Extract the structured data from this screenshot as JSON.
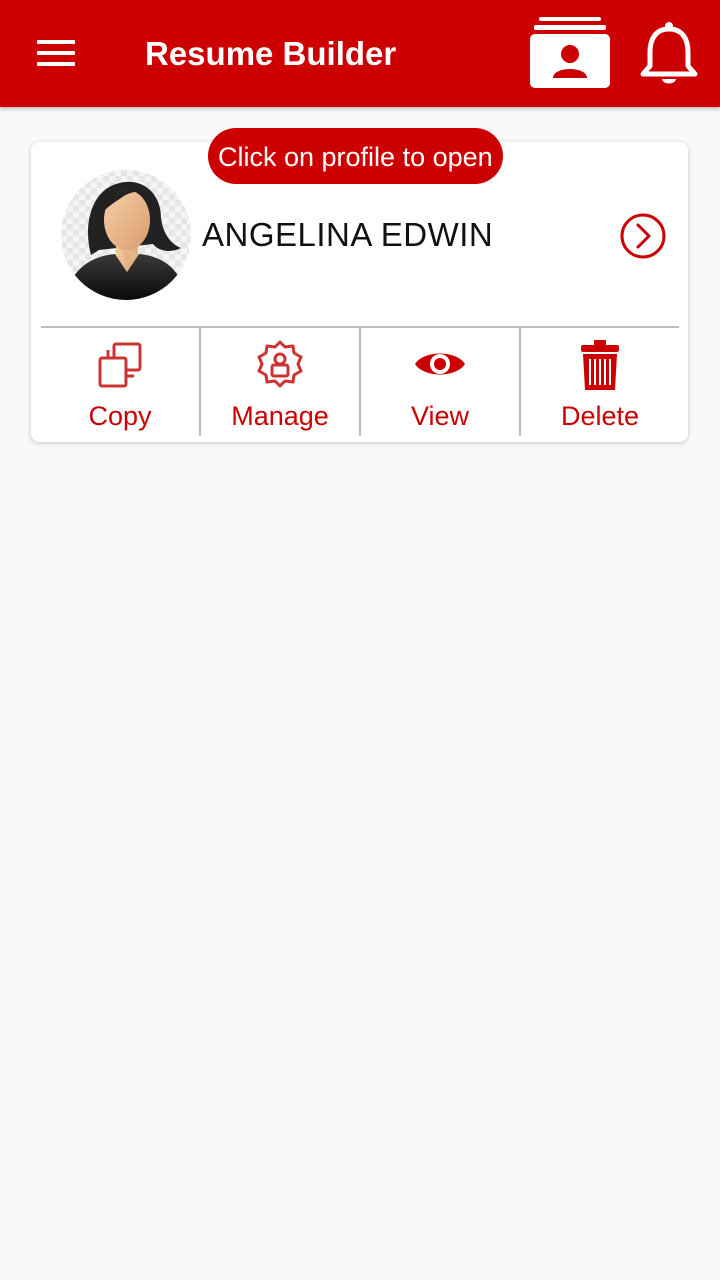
{
  "app": {
    "title": "Resume Builder",
    "accent": "#cc0000",
    "icons": {
      "menu": "hamburger-menu-icon",
      "profiles": "profile-cards-icon",
      "notifications": "bell-icon"
    }
  },
  "profile_card": {
    "hint": "Click on profile to open",
    "name": "ANGELINA EDWIN",
    "avatar": "female-avatar",
    "open_icon": "chevron-right-circle-icon",
    "actions": [
      {
        "label": "Copy",
        "icon": "copy-icon"
      },
      {
        "label": "Manage",
        "icon": "manage-profile-icon"
      },
      {
        "label": "View",
        "icon": "eye-icon"
      },
      {
        "label": "Delete",
        "icon": "trash-icon"
      }
    ]
  }
}
